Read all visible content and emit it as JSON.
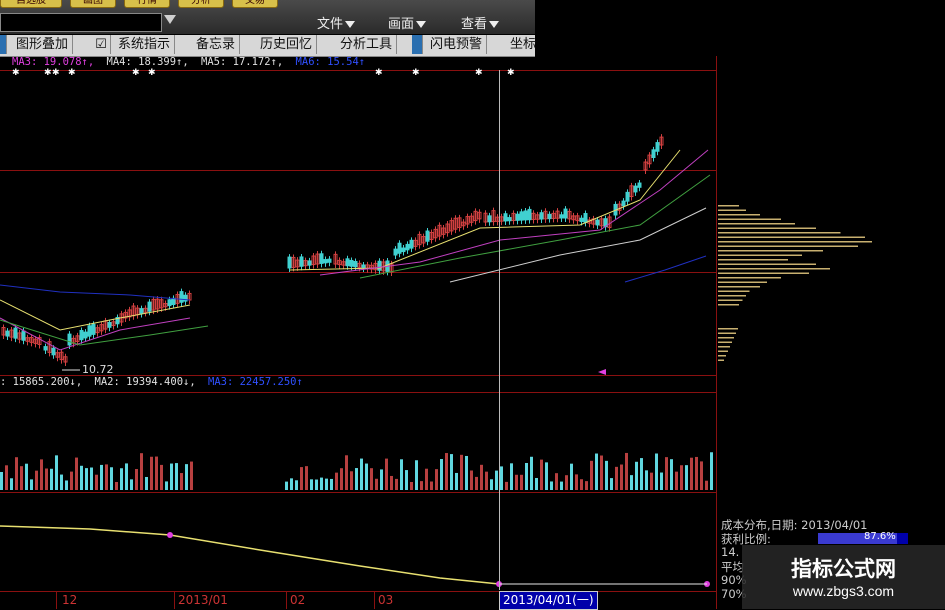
{
  "toolbar": {
    "buttons": [
      "自选股",
      "画图",
      "行情",
      "分析",
      "交易"
    ],
    "menus": [
      "文件",
      "画面",
      "查看"
    ]
  },
  "tool_tabs": [
    "图形叠加",
    "系统指示",
    "备忘录",
    "历史回忆",
    "分析工具",
    "闪电预警",
    "坐标"
  ],
  "price_indicators": [
    {
      "label": "MA3: 19.078↑,",
      "color": "#e040e0"
    },
    {
      "label": "MA4: 18.399↑,",
      "color": "#e0e0e0"
    },
    {
      "label": "MA5: 17.172↑,",
      "color": "#e0e0e0"
    },
    {
      "label": "MA6: 15.54↑",
      "color": "#3050ff"
    }
  ],
  "volume_indicators": [
    {
      "label": ": 15865.200↓,",
      "color": "#e0e0e0"
    },
    {
      "label": "MA2: 19394.400↓,",
      "color": "#e0e0e0"
    },
    {
      "label": "MA3: 22457.250↑",
      "color": "#3050ff"
    }
  ],
  "low_price_label": "10.72",
  "axis": {
    "labels": [
      "12",
      "2013/01",
      "02",
      "03"
    ],
    "cursor_date": "2013/04/01(一)"
  },
  "cost_distribution": {
    "title": "成本分布,日期: 2013/04/01",
    "profit_label": "获利比例:",
    "profit_value": "87.6%",
    "row3": "14.",
    "row4": "平均",
    "row5": "90%",
    "row6": "70%"
  },
  "watermark": {
    "title": "指标公式网",
    "url": "www.zbgs3.com"
  },
  "colors": {
    "grid": "#8a1010",
    "up": "#d24040",
    "down": "#40d0d0",
    "ma_yellow": "#e8e070",
    "ma_magenta": "#c040c0",
    "ma_green": "#40a040",
    "ma_blue": "#2030c0",
    "cost_bar": "#c8b070"
  }
}
